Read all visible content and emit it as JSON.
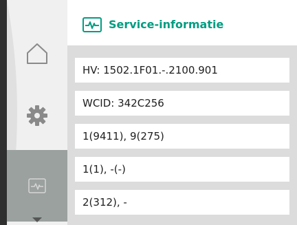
{
  "header": {
    "title": "Service-informatie",
    "icon": "service-info-icon",
    "accent_color": "#009c82"
  },
  "sidebar": {
    "items": [
      {
        "name": "home",
        "icon": "home-icon"
      },
      {
        "name": "settings",
        "icon": "gear-icon"
      },
      {
        "name": "service-info",
        "icon": "service-info-icon",
        "active": true
      }
    ]
  },
  "list": {
    "rows": [
      "HV: 1502.1F01.-.2100.901",
      "WCID: 342C256",
      "1(9411), 9(275)",
      "1(1), -(-)",
      "2(312), -"
    ]
  }
}
